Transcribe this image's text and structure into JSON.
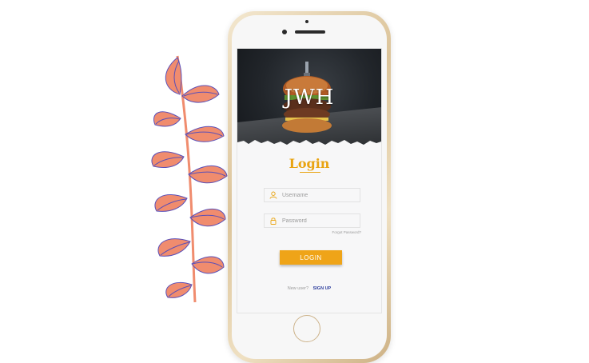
{
  "app": {
    "brand": "JWH"
  },
  "login": {
    "title": "Login",
    "username_placeholder": "Username",
    "password_placeholder": "Password",
    "forgot_label": "Forgot Password?",
    "button_label": "LOGIN",
    "new_user_label": "New user?",
    "signup_label": "SIGN UP"
  },
  "icons": {
    "username": "user-icon",
    "password": "lock-icon",
    "decoration": "leaf-branch-icon"
  },
  "colors": {
    "accent": "#efa418",
    "link": "#2f3f9e",
    "leaf": "#f08c6e",
    "leaf_vein": "#5a4fb8"
  }
}
